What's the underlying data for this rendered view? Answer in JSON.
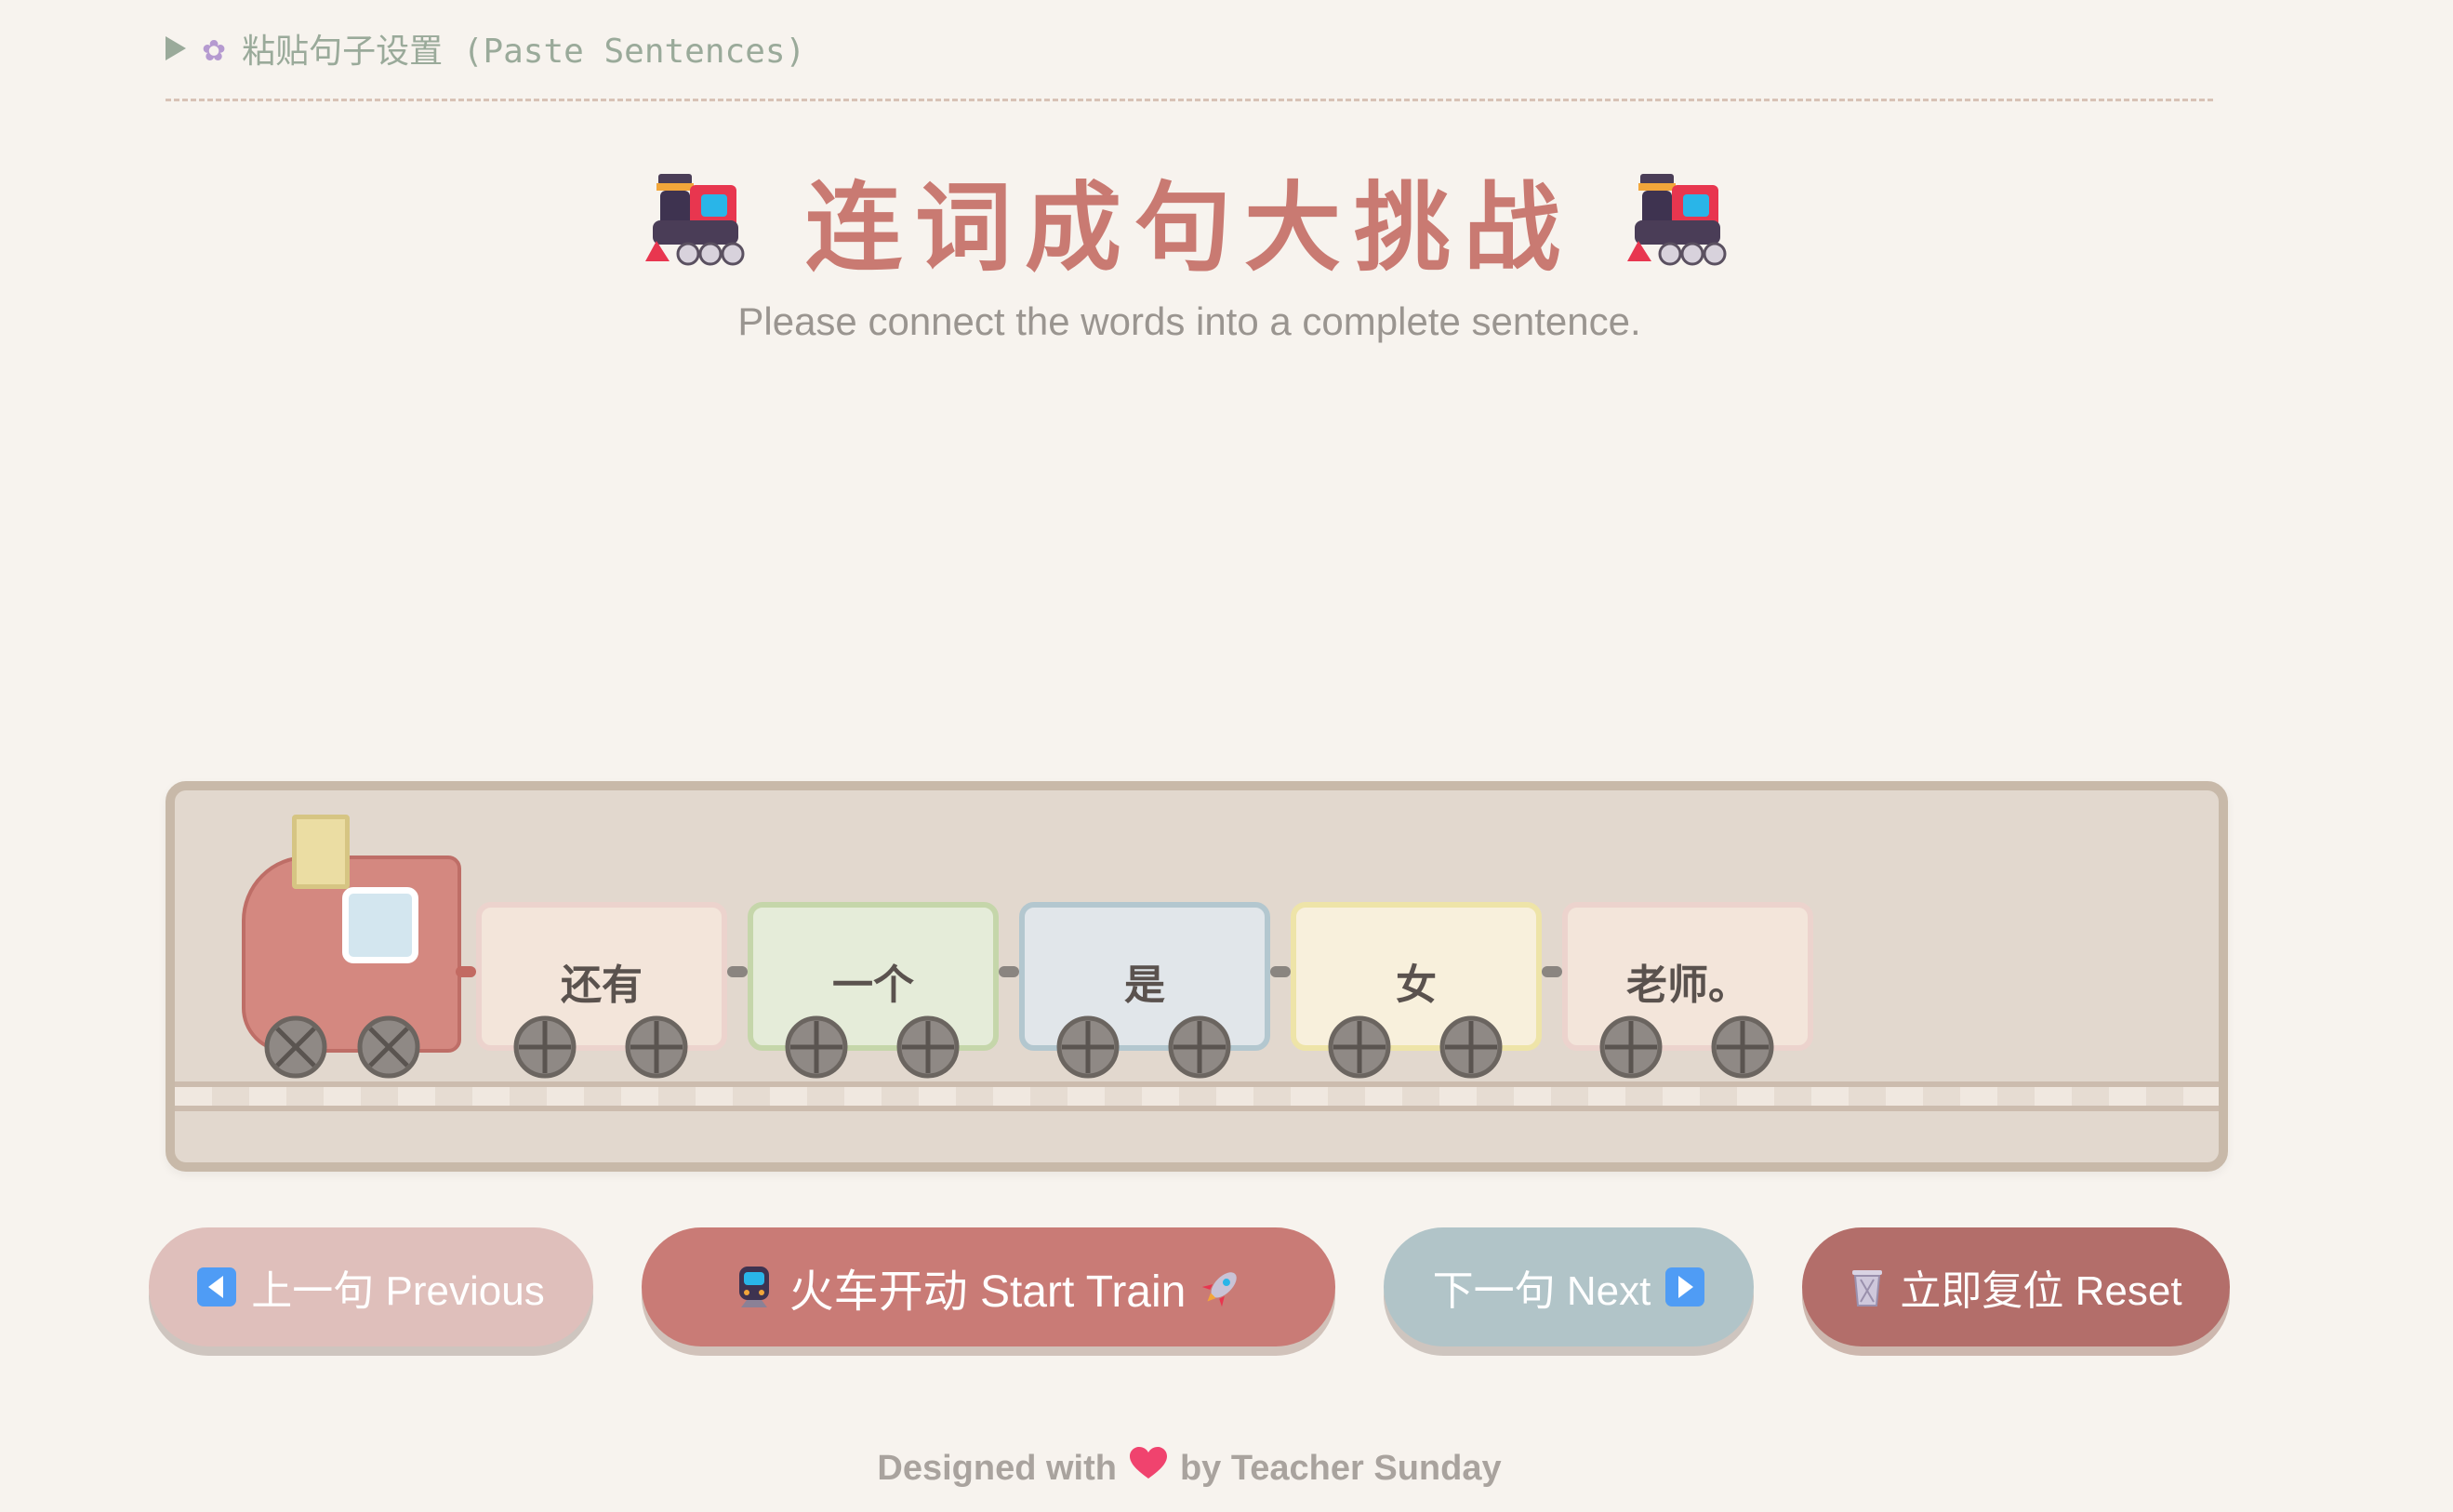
{
  "settings": {
    "label": "粘贴句子设置 (Paste Sentences)",
    "toggle_icon": "caret-right-icon",
    "gear_icon": "gear-icon"
  },
  "header": {
    "title": "连词成句大挑战",
    "subtitle": "Please connect the words into a complete sentence.",
    "decor_icon": "locomotive-icon"
  },
  "train": {
    "wagons": [
      {
        "word": "还有",
        "color": "#f3e5da"
      },
      {
        "word": "一个",
        "color": "#e5ecd9"
      },
      {
        "word": "是",
        "color": "#e1e6ea"
      },
      {
        "word": "女",
        "color": "#f8f0dc"
      },
      {
        "word": "老师。",
        "color": "#f3e5da"
      }
    ]
  },
  "buttons": {
    "previous": {
      "label": "上一句 Previous",
      "icon": "left-arrow-icon",
      "color": "#dfbfbb"
    },
    "start": {
      "label": "火车开动 Start Train",
      "icon_left": "train-front-icon",
      "icon_right": "rocket-icon",
      "color": "#c97b76"
    },
    "next": {
      "label": "下一句 Next",
      "icon": "right-arrow-icon",
      "color": "#b1c4c8"
    },
    "reset": {
      "label": "立即复位 Reset",
      "icon": "trash-icon",
      "color": "#b36e6a"
    }
  },
  "footer": {
    "prefix": "Designed with",
    "suffix": "by Teacher Sunday",
    "heart_icon": "heart-icon"
  }
}
